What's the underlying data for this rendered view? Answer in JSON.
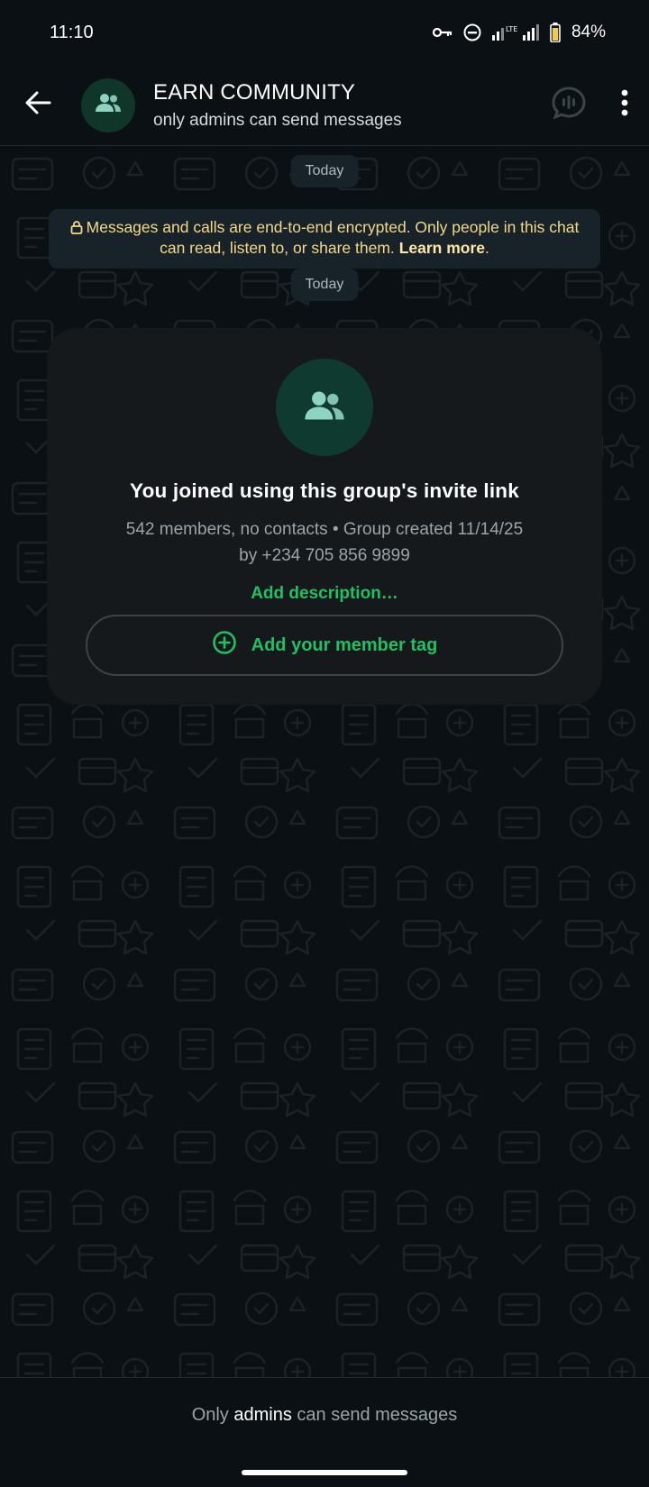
{
  "status_bar": {
    "time": "11:10",
    "network": "LTE",
    "battery": "84%"
  },
  "header": {
    "title": "EARN COMMUNITY",
    "subtitle": "only admins can send messages"
  },
  "chat": {
    "date_top": "Today",
    "encryption_text": "Messages and calls are end-to-end encrypted. Only people in this chat can read, listen to, or share them.",
    "encryption_link": "Learn more",
    "encryption_end": ".",
    "date_second": "Today",
    "card": {
      "title": "You joined using this group's invite link",
      "info_line1": "542 members, no contacts • Group created 11/14/25",
      "info_line2": "by +234 705 856 9899",
      "add_description": "Add description…",
      "member_tag_button": "Add your member tag"
    }
  },
  "footer": {
    "prefix": "Only ",
    "strong": "admins",
    "suffix": " can send messages"
  },
  "colors": {
    "background": "#0b1014",
    "accent_green": "#21c063",
    "encryption_text": "#f4d98a",
    "pill_bg": "#182229"
  },
  "icons": [
    "key-icon",
    "dnd-icon",
    "signal-icon",
    "battery-icon",
    "back-arrow-icon",
    "group-icon",
    "voice-chat-icon",
    "more-vert-icon",
    "lock-icon",
    "add-circle-icon"
  ]
}
